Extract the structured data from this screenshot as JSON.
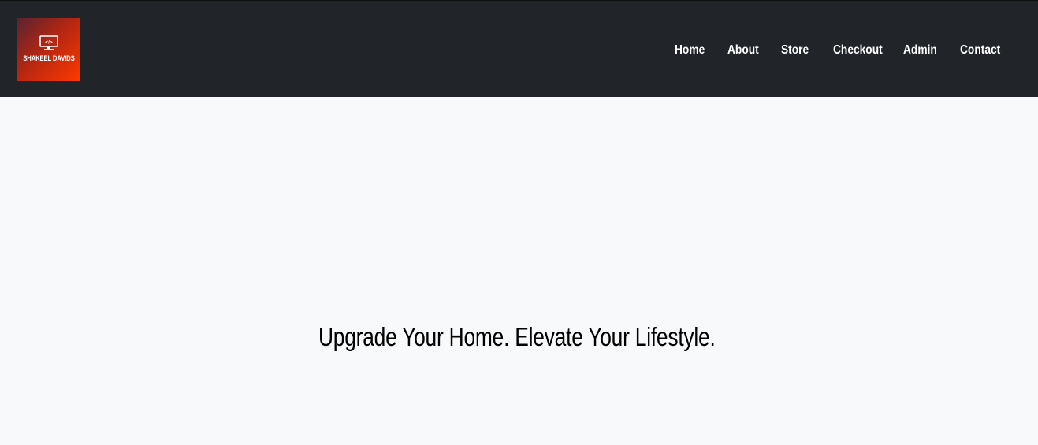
{
  "header": {
    "logo": {
      "text": "SHAKEEL DAVIDS",
      "icon": "monitor-code-icon",
      "gradient_colors": [
        "#5a2330",
        "#ff3a00"
      ]
    },
    "nav": [
      {
        "label": "Home",
        "name": "nav-home"
      },
      {
        "label": "About",
        "name": "nav-about"
      },
      {
        "label": "Store",
        "name": "nav-store"
      },
      {
        "label": "Checkout",
        "name": "nav-checkout"
      },
      {
        "label": "Admin",
        "name": "nav-admin"
      },
      {
        "label": "Contact",
        "name": "nav-contact"
      }
    ],
    "background_color": "#212529",
    "link_color": "#ffffff"
  },
  "hero": {
    "title": "Upgrade Your Home. Elevate Your Lifestyle.",
    "background_color": "#f8f9fa"
  }
}
